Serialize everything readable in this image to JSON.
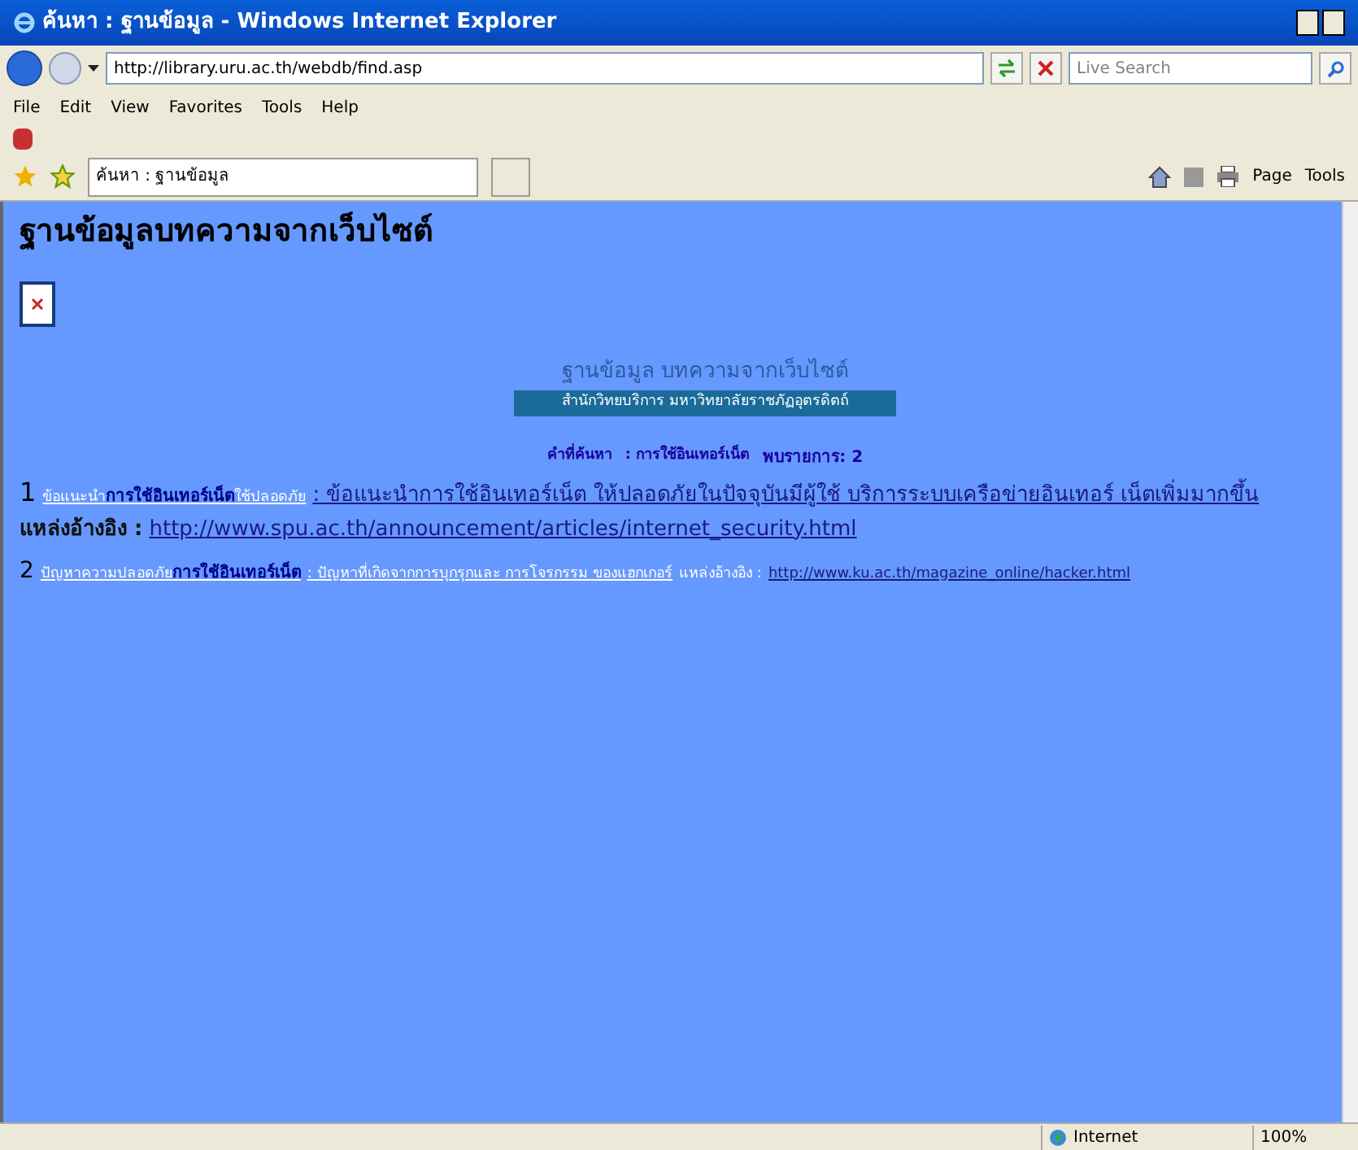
{
  "window": {
    "title": "ค้นหา : ฐานข้อมูล - Windows Internet Explorer"
  },
  "address_bar": {
    "url": "http://library.uru.ac.th/webdb/find.asp"
  },
  "search_box": {
    "placeholder": "Live Search"
  },
  "menu": [
    "File",
    "Edit",
    "View",
    "Favorites",
    "Tools",
    "Help"
  ],
  "tabs": [
    {
      "label": "ค้นหา : ฐานข้อมูล",
      "selected": true
    }
  ],
  "command_bar": [
    "Page",
    "Tools"
  ],
  "page": {
    "heading": "ฐานข้อมูลบทความจากเว็บไซต์",
    "banner_title": "ฐานข้อมูล บทความจากเว็บไซต์",
    "banner_subtitle": "สำนักวิทยบริการ  มหาวิทยาลัยราชภัฏอุตรดิตถ์",
    "search_label": "คำที่ค้นหา",
    "search_term": ": การใช้อินเทอร์เน็ต",
    "result_count": "พบรายการ: 2",
    "results": [
      {
        "kind": "large",
        "number": "1",
        "title_before": "ข้อแนะนำ",
        "keyword": "การใช้อินเทอร์เน็ต",
        "title_after": "ใช้ปลอดภัย",
        "description": ": ข้อแนะนำการใช้อินเทอร์เน็ต ให้ปลอดภัยในปัจจุบันมีผู้ใช้ บริการระบบเครือข่ายอินเทอร์ เน็ตเพิ่มมากขึ้น",
        "source_label": "แหล่งอ้างอิง :",
        "url": "http://www.spu.ac.th/announcement/articles/internet_security.html"
      },
      {
        "kind": "small",
        "number": "2",
        "title_before": "ปัญหาความปลอดภัย",
        "keyword": "การใช้อินเทอร์เน็ต",
        "description": ": ปัญหาที่เกิดจากการบุกรุกและ การโจรกรรม ของแฮกเกอร์",
        "source_label": "แหล่งอ้างอิง :",
        "url": "http://www.ku.ac.th/magazine_online/hacker.html"
      }
    ]
  },
  "status_bar": {
    "zone": "Internet",
    "zoom": "100%"
  }
}
